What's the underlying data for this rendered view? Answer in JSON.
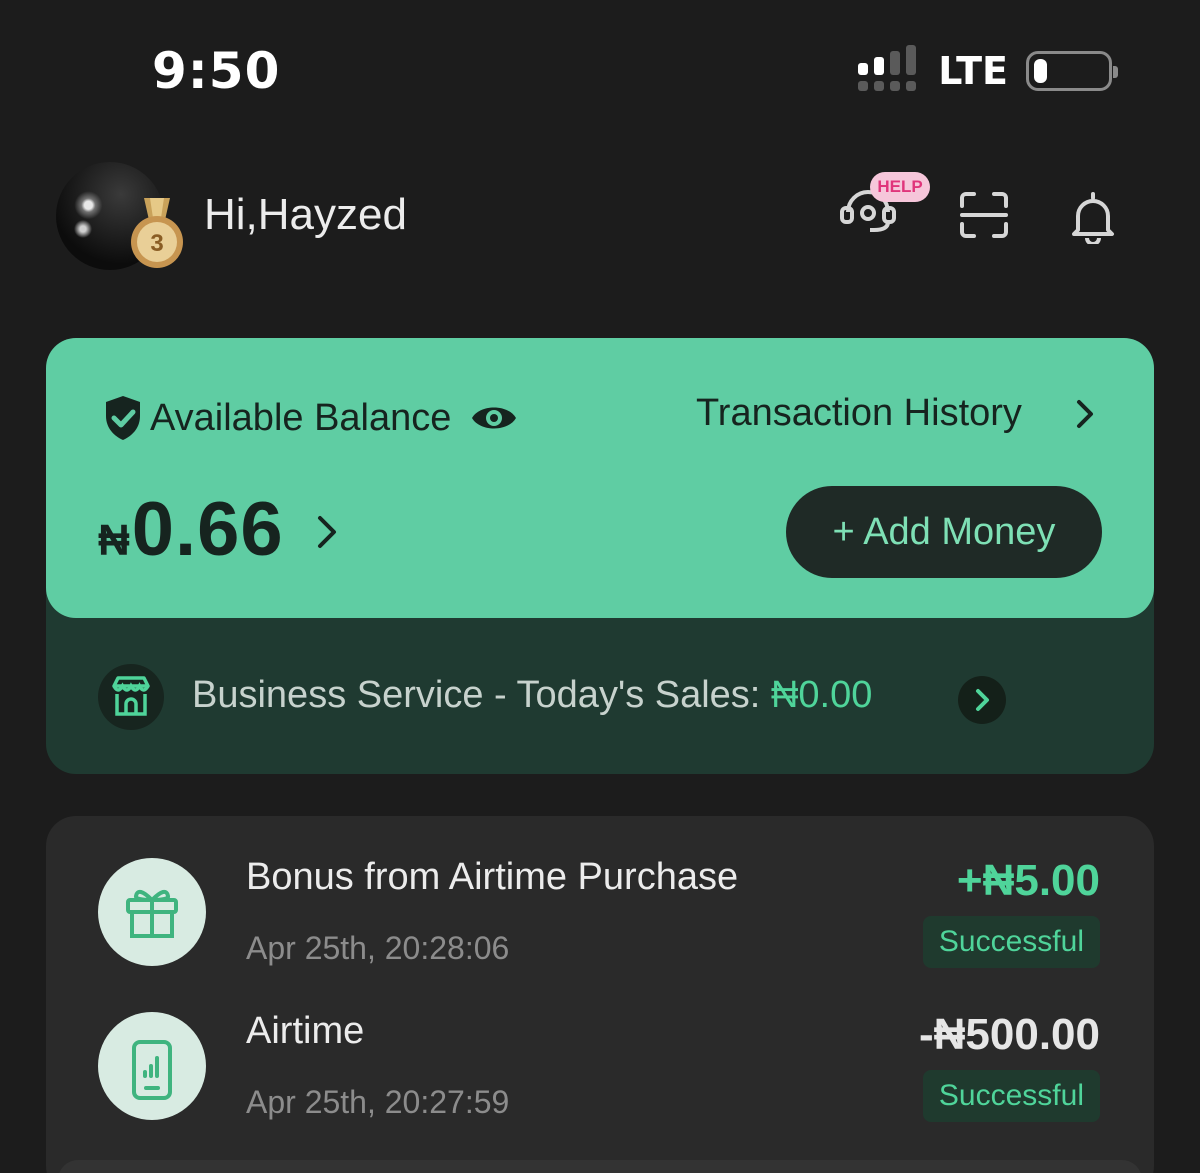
{
  "status_bar": {
    "time": "9:50",
    "network": "LTE",
    "battery_level": 0.18
  },
  "header": {
    "greeting": "Hi,Hayzed",
    "medal_level": "3",
    "help_badge": "HELP",
    "icons": [
      "support-headset-icon",
      "scan-icon",
      "bell-icon"
    ]
  },
  "balance_card": {
    "label": "Available Balance",
    "transaction_history": "Transaction History",
    "currency": "₦",
    "amount": "0.66",
    "add_money": "+ Add Money",
    "business": {
      "label": "Business Service - Today's Sales: ",
      "amount": "₦0.00"
    }
  },
  "transactions": [
    {
      "title": "Bonus from Airtime Purchase",
      "date": "Apr 25th, 20:28:06",
      "amount": "+₦5.00",
      "status": "Successful",
      "icon": "gift-icon"
    },
    {
      "title": "Airtime",
      "date": "Apr 25th, 20:27:59",
      "amount": "-₦500.00",
      "status": "Successful",
      "icon": "phone-signal-icon"
    }
  ],
  "colors": {
    "background": "#1c1c1c",
    "accent_green": "#5fcda3",
    "success_green": "#4fd49a",
    "dark_green": "#1f3a31"
  }
}
